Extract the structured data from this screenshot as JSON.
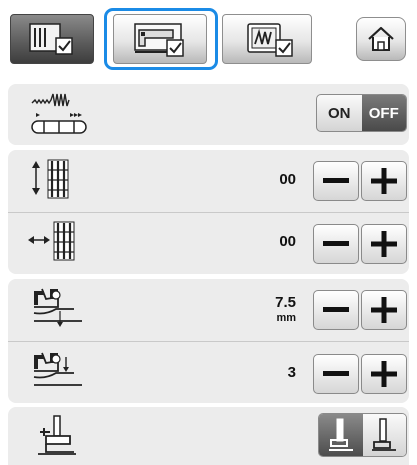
{
  "tabs": [
    {
      "icon": "settings-page-1-icon",
      "state": "inactive"
    },
    {
      "icon": "sewing-machine-settings-icon",
      "state": "selected"
    },
    {
      "icon": "embroidery-settings-icon",
      "state": "inactive"
    }
  ],
  "home": {
    "icon": "home-icon"
  },
  "needle_position_row": {
    "icon": "needle-position-icon",
    "toggle_on_label": "ON",
    "toggle_off_label": "OFF",
    "toggle_state": "OFF"
  },
  "stitch_length_row": {
    "icon": "stitch-length-icon",
    "value": "00"
  },
  "stitch_width_row": {
    "icon": "stitch-width-icon",
    "value": "00"
  },
  "presser_height_row": {
    "icon": "presser-foot-height-icon",
    "value": "7.5",
    "unit": "mm"
  },
  "presser_pressure_row": {
    "icon": "presser-foot-pressure-icon",
    "value": "3"
  },
  "presser_foot_row": {
    "icon": "presser-foot-icon",
    "options": [
      "foot-up-icon",
      "foot-down-icon"
    ],
    "selected": "foot-up-icon"
  },
  "colors": {
    "accent": "#1b8be6",
    "panel": "#ececec",
    "button_dark": "#4d4d4d"
  }
}
